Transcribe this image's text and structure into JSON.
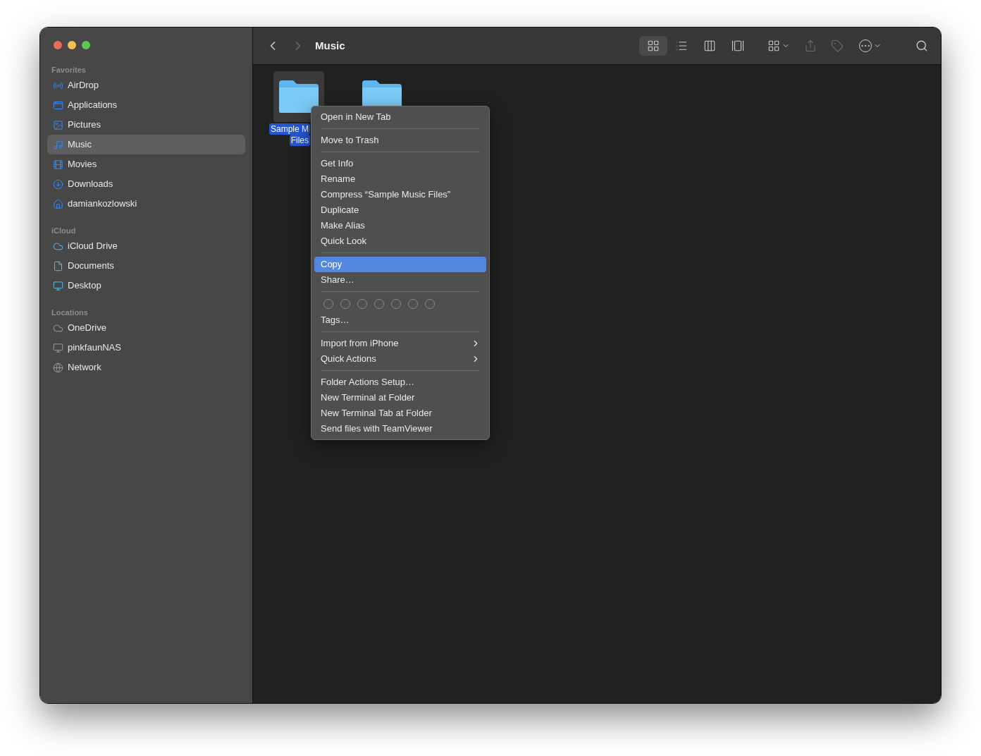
{
  "sidebar": {
    "sections": [
      {
        "title": "Favorites",
        "items": [
          {
            "label": "AirDrop",
            "selected": false
          },
          {
            "label": "Applications",
            "selected": false
          },
          {
            "label": "Pictures",
            "selected": false
          },
          {
            "label": "Music",
            "selected": true
          },
          {
            "label": "Movies",
            "selected": false
          },
          {
            "label": "Downloads",
            "selected": false
          },
          {
            "label": "damiankozlowski",
            "selected": false
          }
        ]
      },
      {
        "title": "iCloud",
        "items": [
          {
            "label": "iCloud Drive",
            "selected": false
          },
          {
            "label": "Documents",
            "selected": false
          },
          {
            "label": "Desktop",
            "selected": false
          }
        ]
      },
      {
        "title": "Locations",
        "items": [
          {
            "label": "OneDrive",
            "selected": false
          },
          {
            "label": "pinkfaunNAS",
            "selected": false
          },
          {
            "label": "Network",
            "selected": false
          }
        ]
      }
    ]
  },
  "toolbar": {
    "title": "Music",
    "views": [
      {
        "selected": true
      },
      {
        "selected": false
      },
      {
        "selected": false
      },
      {
        "selected": false
      }
    ]
  },
  "files": [
    {
      "name_lines": [
        "Sample M",
        "Files"
      ],
      "selected": true,
      "clipped": false
    },
    {
      "selected": false,
      "clipped": true
    }
  ],
  "context_menu": {
    "sections": [
      {
        "kind": "items",
        "items": [
          {
            "label": "Open in New Tab",
            "kind": "item",
            "selected": false
          }
        ]
      },
      {
        "kind": "items",
        "items": [
          {
            "label": "Move to Trash",
            "kind": "item",
            "selected": false
          }
        ]
      },
      {
        "kind": "items",
        "items": [
          {
            "label": "Get Info",
            "kind": "item",
            "selected": false
          },
          {
            "label": "Rename",
            "kind": "item",
            "selected": false
          },
          {
            "label": "Compress “Sample Music Files”",
            "kind": "item",
            "selected": false
          },
          {
            "label": "Duplicate",
            "kind": "item",
            "selected": false
          },
          {
            "label": "Make Alias",
            "kind": "item",
            "selected": false
          },
          {
            "label": "Quick Look",
            "kind": "item",
            "selected": false
          }
        ]
      },
      {
        "kind": "items",
        "items": [
          {
            "label": "Copy",
            "kind": "item",
            "selected": true
          },
          {
            "label": "Share…",
            "kind": "item",
            "selected": false
          }
        ]
      },
      {
        "kind": "tags",
        "items": [
          {
            "label": "Tags…",
            "kind": "item",
            "selected": false
          }
        ]
      },
      {
        "kind": "items",
        "items": [
          {
            "label": "Import from iPhone",
            "kind": "submenu",
            "selected": false
          },
          {
            "label": "Quick Actions",
            "kind": "submenu",
            "selected": false
          }
        ]
      },
      {
        "kind": "items",
        "items": [
          {
            "label": "Folder Actions Setup…",
            "kind": "item",
            "selected": false
          },
          {
            "label": "New Terminal at Folder",
            "kind": "item",
            "selected": false
          },
          {
            "label": "New Terminal Tab at Folder",
            "kind": "item",
            "selected": false
          },
          {
            "label": "Send files with TeamViewer",
            "kind": "item",
            "selected": false
          }
        ]
      }
    ]
  }
}
